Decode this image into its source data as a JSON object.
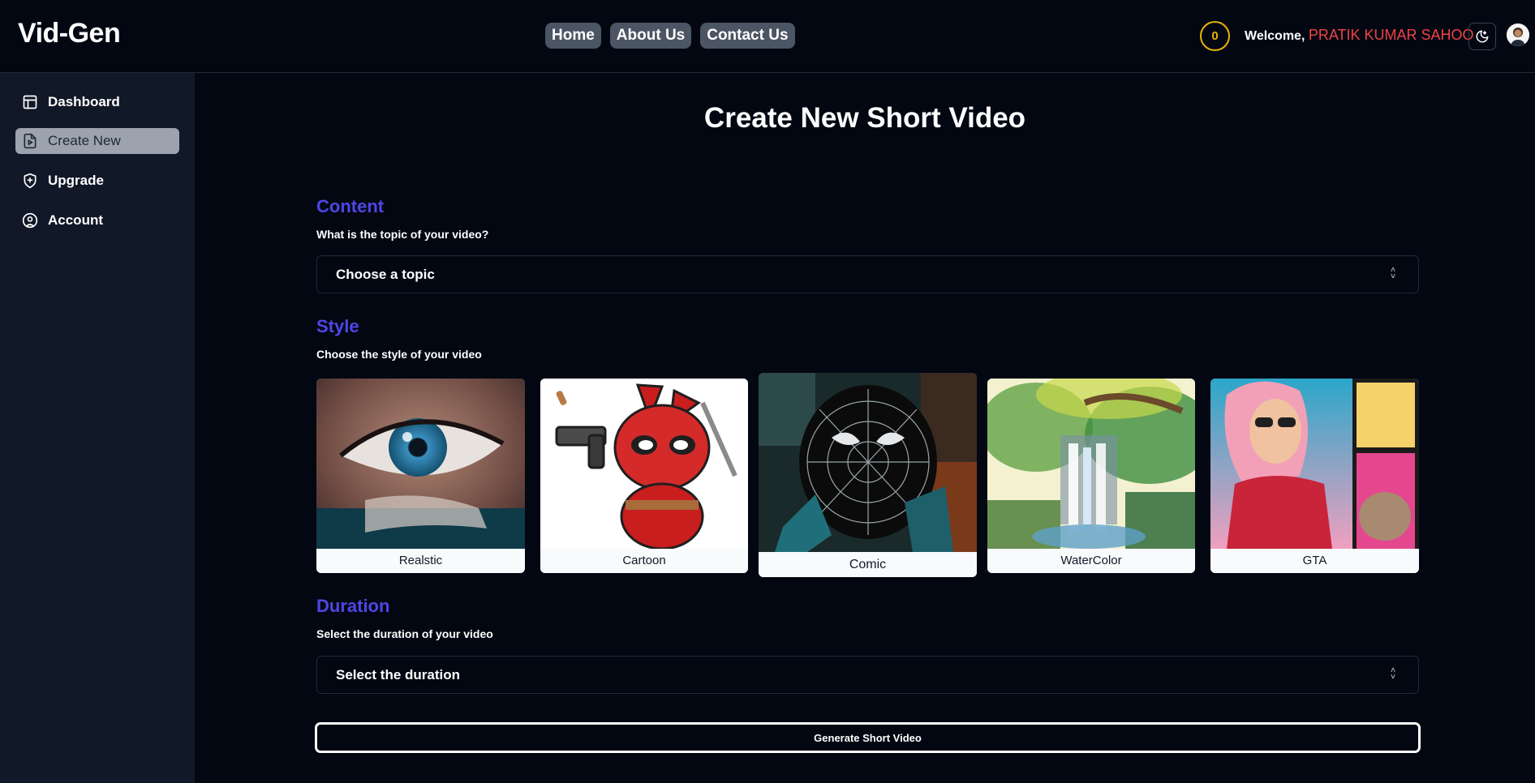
{
  "app": {
    "logo": "Vid-Gen"
  },
  "nav": {
    "items": [
      {
        "label": "Home"
      },
      {
        "label": "About Us"
      },
      {
        "label": "Contact Us"
      }
    ]
  },
  "user": {
    "credits": "0",
    "welcome_prefix": "Welcome, ",
    "name": "PRATIK KUMAR SAHOO",
    "theme_icon": "moon-icon",
    "avatar_icon": "avatar"
  },
  "sidebar": {
    "items": [
      {
        "label": "Dashboard",
        "icon": "layout-icon"
      },
      {
        "label": "Create New",
        "icon": "file-video-icon",
        "active": true
      },
      {
        "label": "Upgrade",
        "icon": "shield-plus-icon"
      },
      {
        "label": "Account",
        "icon": "user-circle-icon"
      }
    ]
  },
  "main": {
    "title": "Create New Short Video",
    "content": {
      "heading": "Content",
      "subheading": "What is the topic of your video?",
      "placeholder": "Choose a topic"
    },
    "style": {
      "heading": "Style",
      "subheading": "Choose the style of your video",
      "options": [
        {
          "label": "Realstic"
        },
        {
          "label": "Cartoon"
        },
        {
          "label": "Comic",
          "selected": true
        },
        {
          "label": "WaterColor"
        },
        {
          "label": "GTA"
        }
      ]
    },
    "duration": {
      "heading": "Duration",
      "subheading": "Select the duration of your video",
      "placeholder": "Select the duration"
    },
    "generate_label": "Generate Short Video"
  },
  "colors": {
    "accent": "#4f46e5",
    "user_name": "#ef4444",
    "credits": "#eab308",
    "background": "#030712",
    "sidebar": "#111827"
  }
}
